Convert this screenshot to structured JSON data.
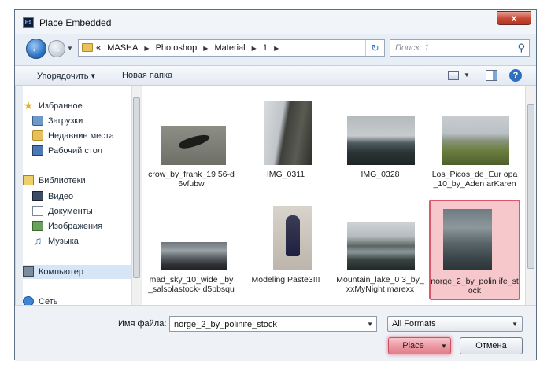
{
  "window": {
    "app_icon": "Ps",
    "title": "Place Embedded",
    "close_label": "x"
  },
  "nav": {
    "back_icon": "back-arrow-icon",
    "forward_icon": "forward-arrow-icon",
    "breadcrumb_prefix": "«",
    "breadcrumbs": [
      "MASHA",
      "Photoshop",
      "Material",
      "1"
    ],
    "search_placeholder": "Поиск: 1"
  },
  "toolbar": {
    "organize_label": "Упорядочить ▾",
    "new_folder_label": "Новая папка"
  },
  "sidebar": {
    "items": [
      {
        "label": "Избранное",
        "icon": "star-icon"
      },
      {
        "label": "Загрузки",
        "icon": "downloads-folder-icon"
      },
      {
        "label": "Недавние места",
        "icon": "recent-places-icon"
      },
      {
        "label": "Рабочий стол",
        "icon": "desktop-icon"
      },
      {
        "label": "Библиотеки",
        "icon": "libraries-icon"
      },
      {
        "label": "Видео",
        "icon": "video-icon"
      },
      {
        "label": "Документы",
        "icon": "documents-icon"
      },
      {
        "label": "Изображения",
        "icon": "pictures-icon"
      },
      {
        "label": "Музыка",
        "icon": "music-icon"
      },
      {
        "label": "Компьютер",
        "icon": "computer-icon"
      },
      {
        "label": "Сеть",
        "icon": "network-icon"
      }
    ]
  },
  "files": [
    {
      "name": "crow_by_frank_19 56-d6vfubw"
    },
    {
      "name": "IMG_0311"
    },
    {
      "name": "IMG_0328"
    },
    {
      "name": "Los_Picos_de_Eur opa_10_by_Aden arKaren"
    },
    {
      "name": "mad_sky_10_wide _by_salsolastock- d5bbsqu"
    },
    {
      "name": "Modeling Paste3!!!"
    },
    {
      "name": "Mountain_lake_0 3_by_xxMyNight marexx"
    },
    {
      "name": "norge_2_by_polin ife_stock",
      "selected": true
    }
  ],
  "footer": {
    "filename_label": "Имя файла:",
    "filename_value": "norge_2_by_polinife_stock",
    "format_value": "All Formats",
    "place_label": "Place",
    "cancel_label": "Отмена"
  },
  "colors": {
    "selection": "#d9596a",
    "accent": "#2f6fbf"
  }
}
